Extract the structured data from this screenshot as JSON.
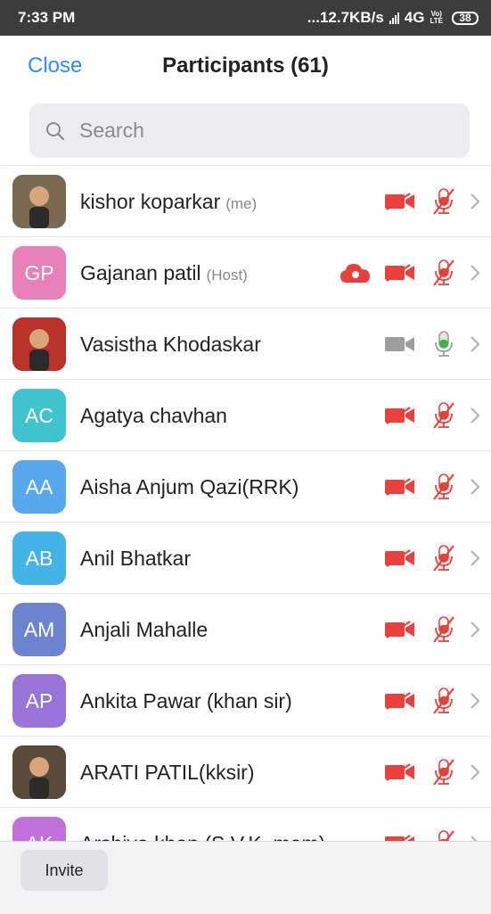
{
  "status_bar": {
    "time": "7:33 PM",
    "speed": "...12.7KB/s",
    "network": "4G",
    "volte_top": "Vo)",
    "volte_bottom": "LTE",
    "battery": "38"
  },
  "header": {
    "close_label": "Close",
    "title": "Participants (61)"
  },
  "search": {
    "placeholder": "Search"
  },
  "colors": {
    "accent": "#2d8cff",
    "muted_red": "#e8413d",
    "mic_green": "#3bb54a",
    "camera_gray": "#9e9e9e"
  },
  "participants": [
    {
      "name": "kishor koparkar",
      "tag": "(me)",
      "initials": "",
      "avatar_color": "#7a6a52",
      "photo": true,
      "recording": false,
      "video_off": true,
      "mic": "muted"
    },
    {
      "name": "Gajanan patil",
      "tag": "(Host)",
      "initials": "GP",
      "avatar_color": "#e881b8",
      "photo": false,
      "recording": true,
      "video_off": true,
      "mic": "muted"
    },
    {
      "name": "Vasistha Khodaskar",
      "tag": "",
      "initials": "",
      "avatar_color": "#b8322a",
      "photo": true,
      "recording": false,
      "video_off": false,
      "mic": "active"
    },
    {
      "name": "Agatya chavhan",
      "tag": "",
      "initials": "AC",
      "avatar_color": "#3fc3cc",
      "photo": false,
      "recording": false,
      "video_off": true,
      "mic": "muted"
    },
    {
      "name": "Aisha Anjum Qazi(RRK)",
      "tag": "",
      "initials": "AA",
      "avatar_color": "#58a8ee",
      "photo": false,
      "recording": false,
      "video_off": true,
      "mic": "muted"
    },
    {
      "name": "Anil Bhatkar",
      "tag": "",
      "initials": "AB",
      "avatar_color": "#43b3e8",
      "photo": false,
      "recording": false,
      "video_off": true,
      "mic": "muted"
    },
    {
      "name": "Anjali Mahalle",
      "tag": "",
      "initials": "AM",
      "avatar_color": "#6c84cf",
      "photo": false,
      "recording": false,
      "video_off": true,
      "mic": "muted"
    },
    {
      "name": "Ankita Pawar (khan sir)",
      "tag": "",
      "initials": "AP",
      "avatar_color": "#9a73d8",
      "photo": false,
      "recording": false,
      "video_off": true,
      "mic": "muted"
    },
    {
      "name": "ARATI PATIL(kksir)",
      "tag": "",
      "initials": "",
      "avatar_color": "#5a4a3a",
      "photo": true,
      "recording": false,
      "video_off": true,
      "mic": "muted"
    },
    {
      "name": "Arshiya khan (S.V.K. mam)",
      "tag": "",
      "initials": "AK",
      "avatar_color": "#c070d8",
      "photo": false,
      "recording": false,
      "video_off": true,
      "mic": "muted"
    }
  ],
  "footer": {
    "invite_label": "Invite"
  }
}
